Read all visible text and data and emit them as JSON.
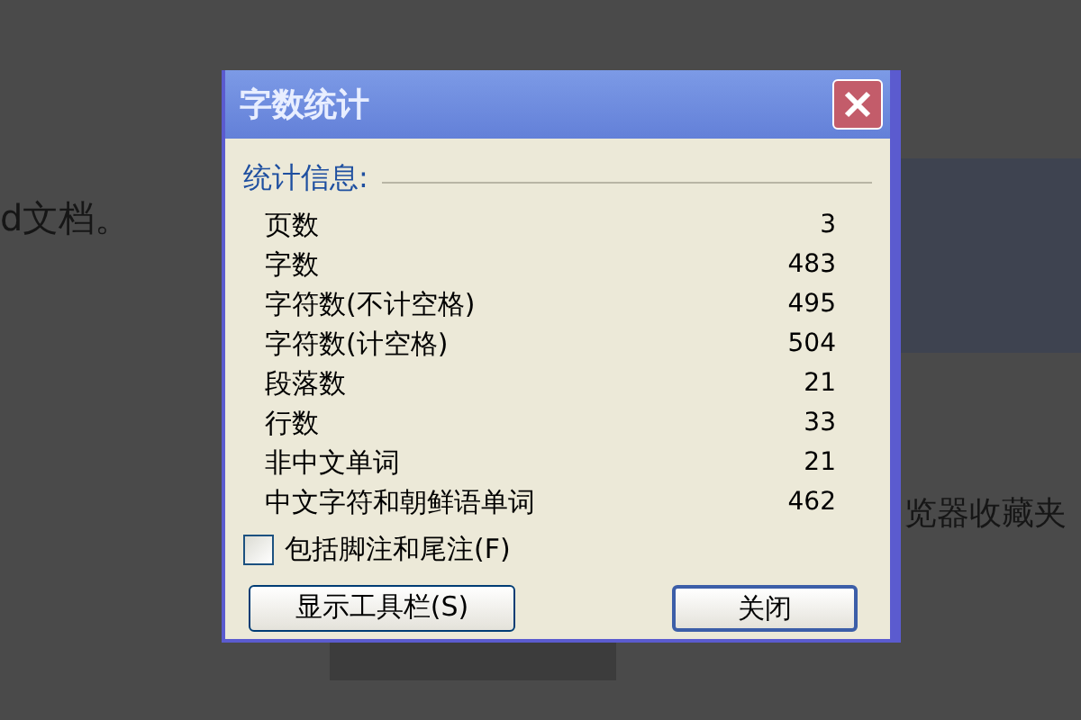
{
  "background": {
    "left_text": "d文档。",
    "right_heading": "览器收藏夹"
  },
  "dialog": {
    "title": "字数统计",
    "section_label": "统计信息:",
    "stats": [
      {
        "label": "页数",
        "value": "3"
      },
      {
        "label": "字数",
        "value": "483"
      },
      {
        "label": "字符数(不计空格)",
        "value": "495"
      },
      {
        "label": "字符数(计空格)",
        "value": "504"
      },
      {
        "label": "段落数",
        "value": "21"
      },
      {
        "label": "行数",
        "value": "33"
      },
      {
        "label": "非中文单词",
        "value": "21"
      },
      {
        "label": "中文字符和朝鲜语单词",
        "value": "462"
      }
    ],
    "checkbox": {
      "label": "包括脚注和尾注(F)",
      "checked": false
    },
    "buttons": [
      {
        "label": "显示工具栏(S)",
        "kind": "secondary"
      },
      {
        "label": "关闭",
        "kind": "default"
      }
    ]
  }
}
